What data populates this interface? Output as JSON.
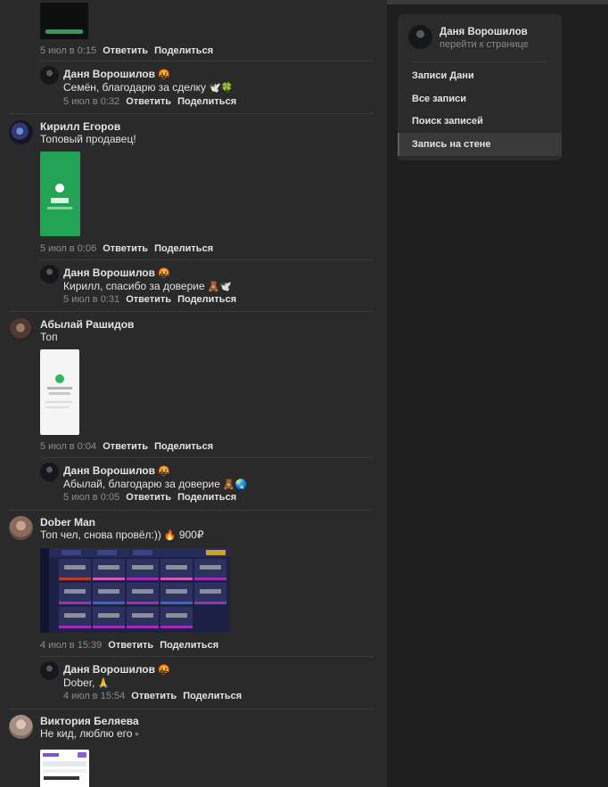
{
  "actions": {
    "reply": "Ответить",
    "share": "Поделиться"
  },
  "feed": {
    "top_meta": {
      "time": "5 июл в 0:15"
    },
    "comments": [
      {
        "author": "Даня Ворошилов",
        "author_emoji": "🤬",
        "text": "Семён, благодарю за сделку",
        "text_emoji": "🕊️🍀",
        "time": "5 июл в 0:32"
      },
      {
        "author": "Кирилл Егоров",
        "text": "Топовый продавец!",
        "time": "5 июл в 0:06"
      },
      {
        "author": "Даня Ворошилов",
        "author_emoji": "🤬",
        "text": "Кирилл, спасибо за доверие",
        "text_emoji": "🧸🕊️",
        "time": "5 июл в 0:31"
      },
      {
        "author": "Абылай Рашидов",
        "text": "Топ",
        "time": "5 июл в 0:04"
      },
      {
        "author": "Даня Ворошилов",
        "author_emoji": "🤬",
        "text": "Абылай, благодарю за доверие",
        "text_emoji": "🧸🌏",
        "time": "5 июл в 0:05"
      },
      {
        "author": "Dober Man",
        "text": "Топ чел, снова провёл:))",
        "text_emoji": "🔥",
        "text_suffix": "900₽",
        "time": "4 июл в 15:39"
      },
      {
        "author": "Даня Ворошилов",
        "author_emoji": "🤬",
        "text": "Dober,",
        "text_emoji": "🙏",
        "time": "4 июл в 15:54"
      },
      {
        "author": "Виктория Беляева",
        "text": "Не кид, люблю его",
        "text_emoji": "▫"
      }
    ]
  },
  "sidebar": {
    "profile_name": "Даня Ворошилов",
    "profile_link": "перейти к странице",
    "menu": [
      {
        "label": "Записи Дани"
      },
      {
        "label": "Все записи"
      },
      {
        "label": "Поиск записей"
      },
      {
        "label": "Запись на стене"
      }
    ]
  },
  "colors": {
    "feed_bg": "#2a2a2b",
    "page_bg": "#1e1e1f",
    "divider": "#3b3b3c",
    "meta": "#8c8c8c"
  }
}
